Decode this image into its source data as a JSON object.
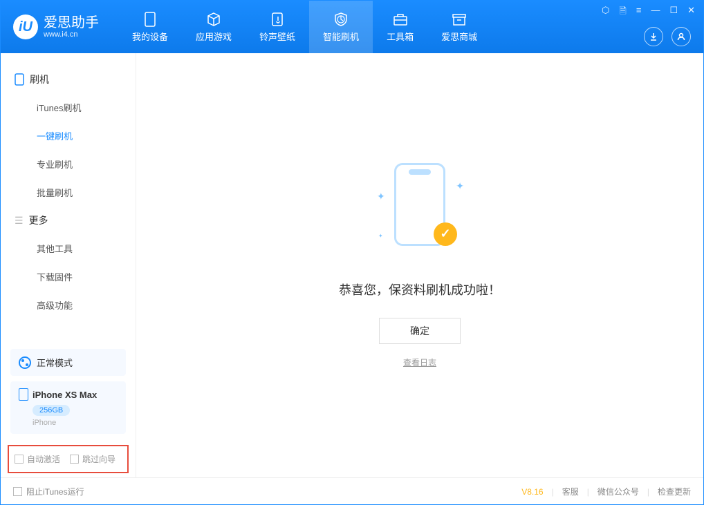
{
  "logo": {
    "title": "爱思助手",
    "url": "www.i4.cn"
  },
  "tabs": [
    {
      "label": "我的设备"
    },
    {
      "label": "应用游戏"
    },
    {
      "label": "铃声壁纸"
    },
    {
      "label": "智能刷机"
    },
    {
      "label": "工具箱"
    },
    {
      "label": "爱思商城"
    }
  ],
  "sidebar": {
    "section1_title": "刷机",
    "items1": [
      {
        "label": "iTunes刷机"
      },
      {
        "label": "一键刷机"
      },
      {
        "label": "专业刷机"
      },
      {
        "label": "批量刷机"
      }
    ],
    "section2_title": "更多",
    "items2": [
      {
        "label": "其他工具"
      },
      {
        "label": "下载固件"
      },
      {
        "label": "高级功能"
      }
    ],
    "mode": "正常模式",
    "device_name": "iPhone XS Max",
    "device_storage": "256GB",
    "device_type": "iPhone",
    "cb_auto_activate": "自动激活",
    "cb_skip_guide": "跳过向导"
  },
  "main": {
    "success_message": "恭喜您，保资料刷机成功啦！",
    "ok_button": "确定",
    "view_log": "查看日志"
  },
  "footer": {
    "block_itunes": "阻止iTunes运行",
    "version": "V8.16",
    "customer_service": "客服",
    "wechat": "微信公众号",
    "check_update": "检查更新"
  }
}
